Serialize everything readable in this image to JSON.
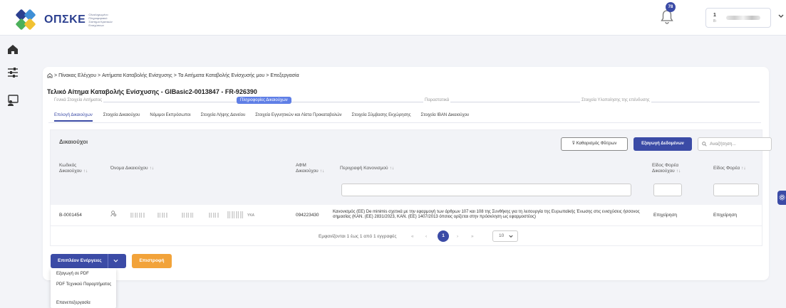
{
  "brand": {
    "name": "ΟΠΣΚΕ",
    "tagline": "Ολοκληρωμένο Πληροφοριακό Σύστημα Κρατικών Ενισχύσεων",
    "colors": [
      "#2b3f8f",
      "#4cb05a",
      "#f1c232",
      "#3f8fd6"
    ]
  },
  "header": {
    "notification_count": "78",
    "user": {
      "line1": "1",
      "line2": "B-"
    }
  },
  "sidebar": {
    "icons": [
      "home-icon",
      "sliders-icon",
      "monitor-user-icon"
    ]
  },
  "breadcrumb": {
    "items": [
      "Πίνακας Ελέγχου",
      "Αιτήματα Καταβολής Ενίσχυσης",
      "Τα Αιτήματα Καταβολής Ενίσχυσής μου",
      "Επεξεργασία"
    ],
    "separator": ">"
  },
  "page": {
    "title": "Τελικό Αίτημα Καταβολής Ενίσχυσης - GIBasic2-0013847 - FR-926390"
  },
  "stepper": {
    "steps": [
      "Γενικά Στοιχεία Αιτήματος",
      "Πληροφορίες Δικαιούχων",
      "Παραστατικά",
      "Στοιχεία Υλοποίησης της επένδυσης"
    ],
    "active": "Πληροφορίες Δικαιούχων"
  },
  "tabs": [
    {
      "label": "Επιλογή Δικαιούχων",
      "active": true
    },
    {
      "label": "Στοιχεία Δικαιούχου"
    },
    {
      "label": "Νόμιμοι Εκπρόσωποι"
    },
    {
      "label": "Στοιχεία Λήψης Δανείου"
    },
    {
      "label": "Στοιχεία Εγγυητικών και Λίστα Προκαταβολών"
    },
    {
      "label": "Στοιχεία Σύμβασης Εκχώρησης"
    },
    {
      "label": "Στοιχεία IBAN Δικαιούχου"
    }
  ],
  "grid": {
    "caption": "Δικαιούχοι",
    "clear_filters": "Καθαρισμός Φίλτρων",
    "export": "Εξαγωγή Δεδομένων",
    "search_placeholder": "Αναζήτηση...",
    "columns": {
      "code": "Κωδικός Δικαιούχου",
      "name": "Όνομα Δικαιούχου",
      "afm": "ΑΦΜ Δικαιούχου",
      "regulation": "Περιγραφή Κανονισμού",
      "carrier_type_beneficiary": "Είδος Φορέα Δικαιούχου",
      "carrier_type": "Είδος Φορέα"
    },
    "sort_glyph": "↑↓",
    "rows": [
      {
        "code": "B-0001454",
        "afm": "094223430",
        "regulation": "Κανονισμός (ΕΕ) De minimis σχετικά με την εφαρμογή των άρθρων 107 και 108 της Συνθήκης για τη λειτουργία της Ευρωπαϊκής Ένωσης στις ενισχύσεις ήσσονος σημασίας (ΚΑΝ. (ΕΕ) 2831/2023, ΚΑΝ. (ΕΕ) 1407/2013 όπσιος ορίζεται στην πρόσκληση ως εφαρμοστέος)",
        "carrier_type_beneficiary": "Επιχείρηση",
        "carrier_type": "Επιχείρηση",
        "name_fragment": "ΥΚΑ"
      }
    ],
    "pager": {
      "summary": "Εμφανίζονται 1 έως 1 από 1 εγγραφές",
      "first": "«",
      "prev": "‹",
      "current": "1",
      "next": "›",
      "last": "»",
      "page_size": "10"
    }
  },
  "actions": {
    "more": "Επιπλέον Ενέργειες",
    "back": "Επιστροφή",
    "menu": [
      "Εξαγωγή σε PDF",
      "PDF Τεχνικού Παραρτήματος",
      "Επανεπεξεργασία"
    ]
  }
}
